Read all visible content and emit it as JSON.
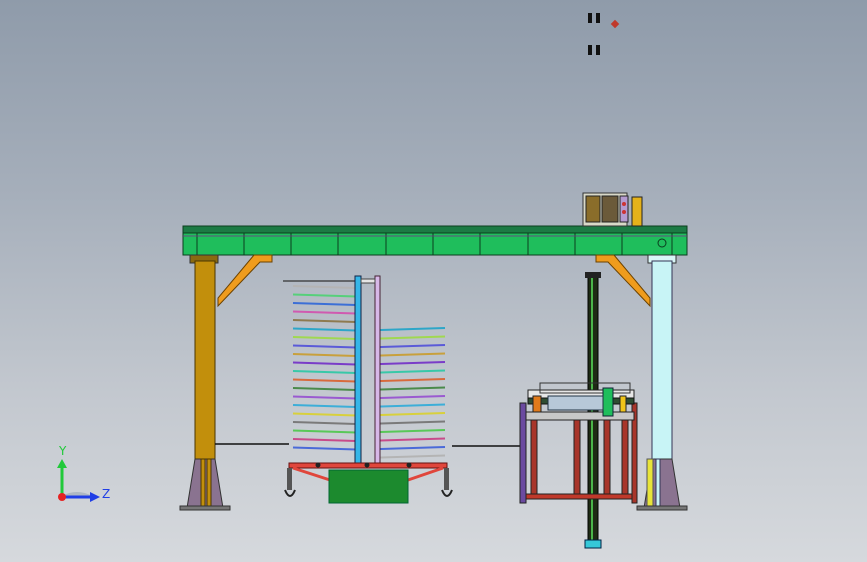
{
  "viewport": {
    "background_top": "#8f9baa",
    "background_bottom": "#d6d9dd"
  },
  "model": {
    "description_colors": {
      "crossbeam": "#1fbe5c",
      "left_column": "#c28f0c",
      "right_column": "#c8f4f6",
      "braces": "#ef9c1d",
      "cart_frame": "#e0463c",
      "cart_box": "#1c8a2e",
      "mast": "#1e2b14",
      "table_frame": "#a8352a"
    }
  },
  "triad": {
    "y_label": "Y",
    "z_label": "Z",
    "y_color": "#21c93a",
    "z_color": "#1f3ee6",
    "origin_color": "#e52222"
  }
}
